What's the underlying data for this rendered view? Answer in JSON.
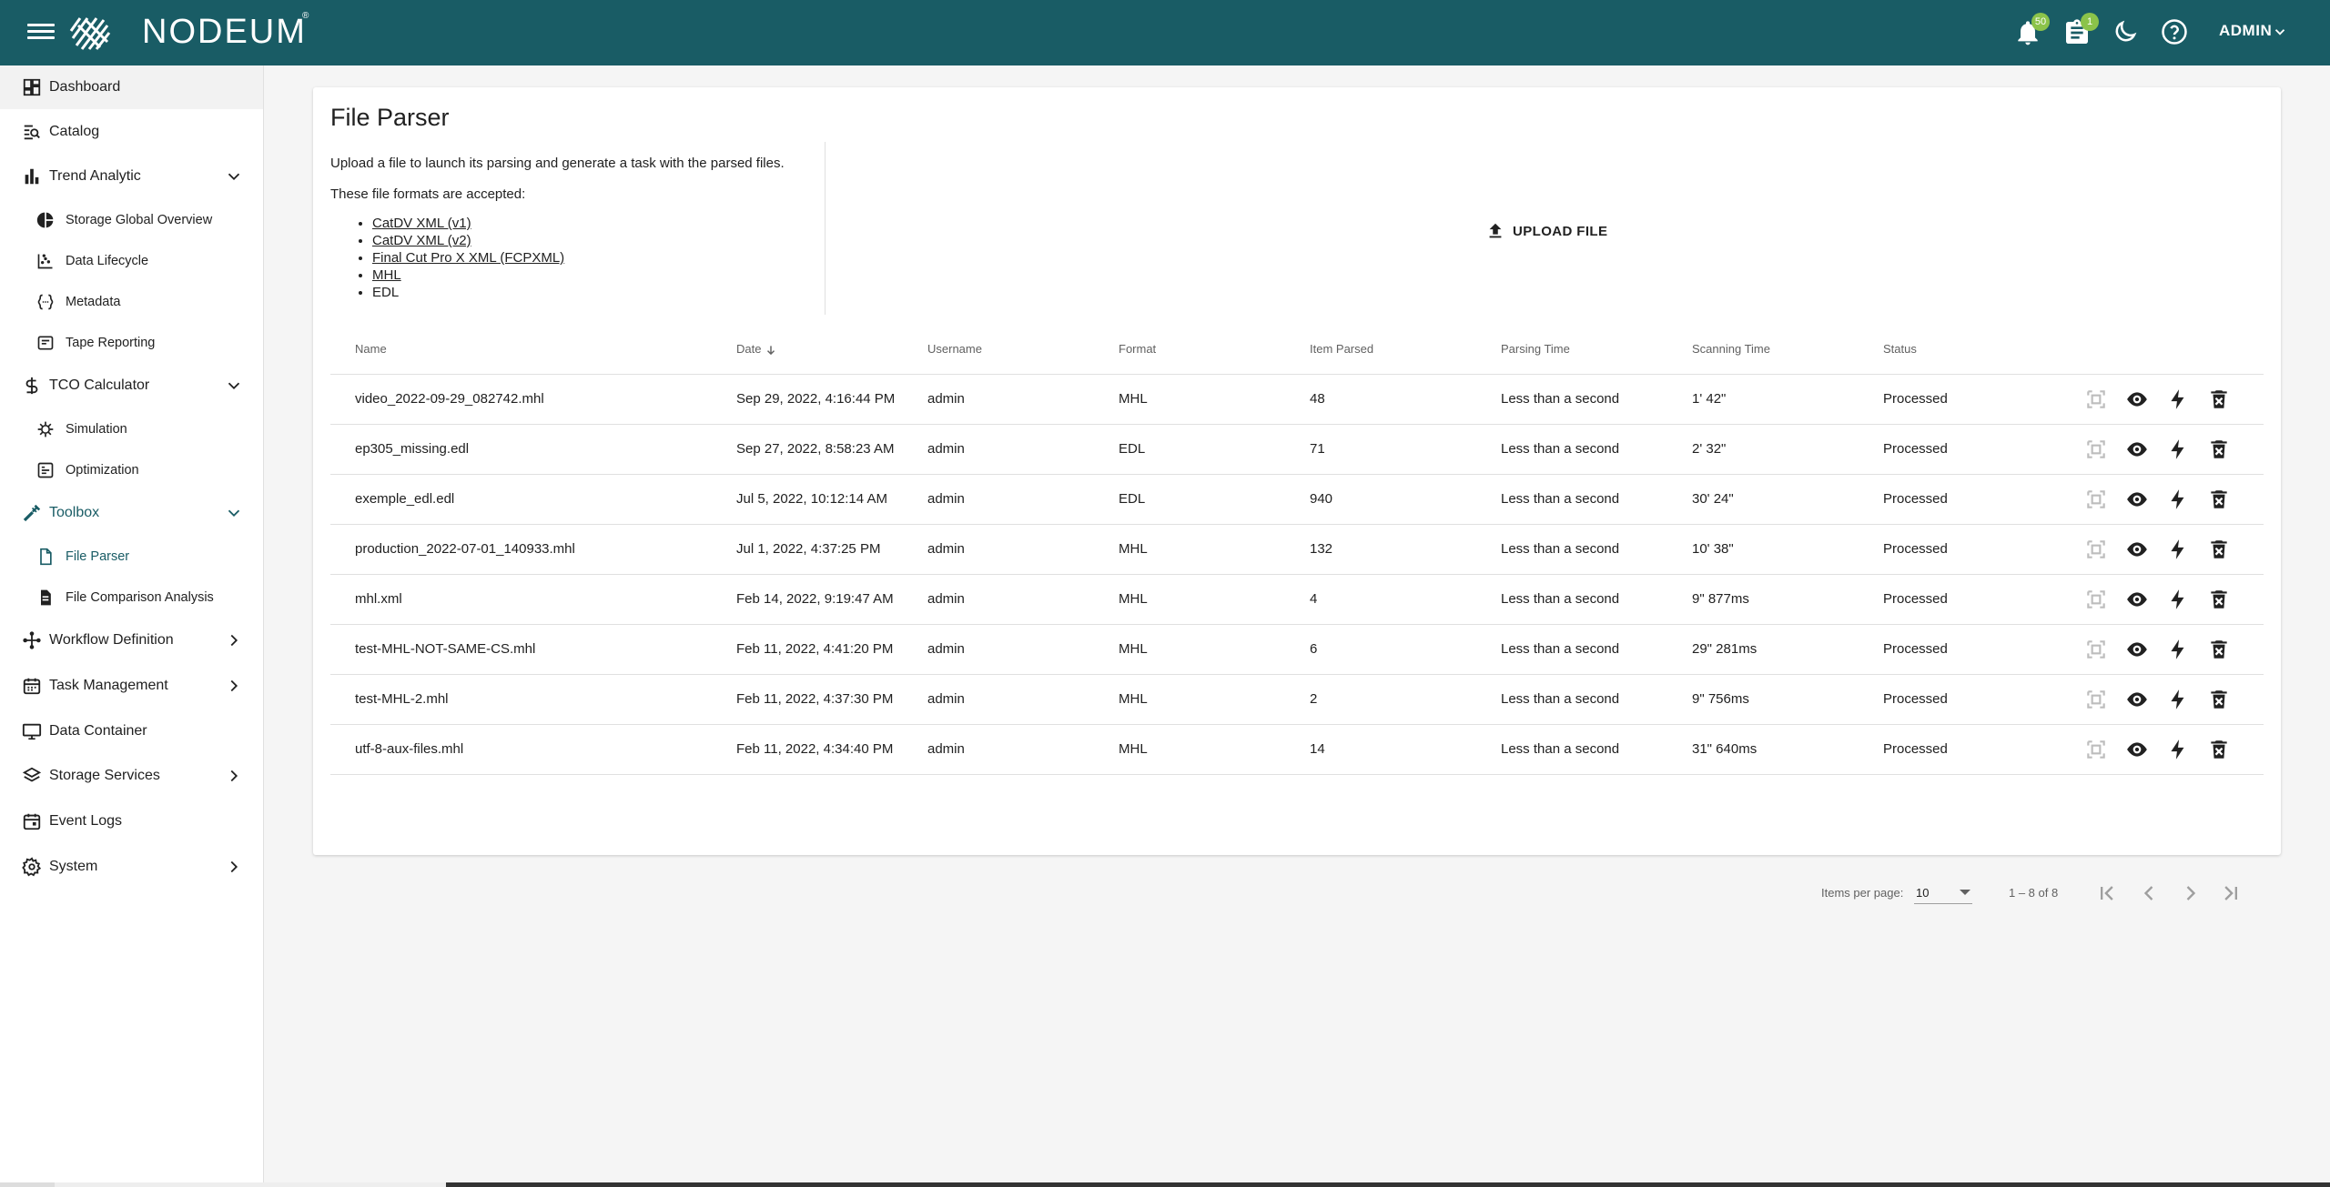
{
  "topbar": {
    "brand": "NODEUM",
    "registered": "®",
    "notifications_count": "50",
    "tasks_count": "1",
    "user_label": "ADMIN",
    "bg_color": "#195c65"
  },
  "sidebar": {
    "items": [
      {
        "label": "Dashboard",
        "icon": "dashboard-icon"
      },
      {
        "label": "Catalog",
        "icon": "catalog-search-icon"
      },
      {
        "label": "Trend Analytic",
        "icon": "bar-chart-icon"
      },
      {
        "label": "Storage Global Overview",
        "icon": "pie-chart-icon"
      },
      {
        "label": "Data Lifecycle",
        "icon": "scatter-chart-icon"
      },
      {
        "label": "Metadata",
        "icon": "code-braces-icon"
      },
      {
        "label": "Tape Reporting",
        "icon": "tape-report-icon"
      },
      {
        "label": "TCO Calculator",
        "icon": "dollar-icon"
      },
      {
        "label": "Simulation",
        "icon": "simulation-icon"
      },
      {
        "label": "Optimization",
        "icon": "optimization-icon"
      },
      {
        "label": "Toolbox",
        "icon": "tools-icon"
      },
      {
        "label": "File Parser",
        "icon": "file-icon"
      },
      {
        "label": "File Comparison Analysis",
        "icon": "file-compare-icon"
      },
      {
        "label": "Workflow Definition",
        "icon": "workflow-icon"
      },
      {
        "label": "Task Management",
        "icon": "calendar-icon"
      },
      {
        "label": "Data Container",
        "icon": "monitor-icon"
      },
      {
        "label": "Storage Services",
        "icon": "layers-icon"
      },
      {
        "label": "Event Logs",
        "icon": "event-icon"
      },
      {
        "label": "System",
        "icon": "gear-icon"
      }
    ]
  },
  "page": {
    "title": "File Parser",
    "intro_line1": "Upload a file to launch its parsing and generate a task with the parsed files.",
    "intro_line2": "These file formats are accepted:",
    "formats": [
      "CatDV XML (v1)",
      "CatDV XML (v2)",
      "Final Cut Pro X XML (FCPXML)",
      "MHL",
      "EDL"
    ],
    "upload_label": "UPLOAD FILE"
  },
  "table": {
    "headers": [
      "Name",
      "Date",
      "Username",
      "Format",
      "Item Parsed",
      "Parsing Time",
      "Scanning Time",
      "Status"
    ],
    "rows": [
      [
        "video_2022-09-29_082742.mhl",
        "Sep 29, 2022, 4:16:44 PM",
        "admin",
        "MHL",
        "48",
        "Less than a second",
        "1' 42\"",
        "Processed"
      ],
      [
        "ep305_missing.edl",
        "Sep 27, 2022, 8:58:23 AM",
        "admin",
        "EDL",
        "71",
        "Less than a second",
        "2' 32\"",
        "Processed"
      ],
      [
        "exemple_edl.edl",
        "Jul 5, 2022, 10:12:14 AM",
        "admin",
        "EDL",
        "940",
        "Less than a second",
        "30' 24\"",
        "Processed"
      ],
      [
        "production_2022-07-01_140933.mhl",
        "Jul 1, 2022, 4:37:25 PM",
        "admin",
        "MHL",
        "132",
        "Less than a second",
        "10' 38\"",
        "Processed"
      ],
      [
        "mhl.xml",
        "Feb 14, 2022, 9:19:47 AM",
        "admin",
        "MHL",
        "4",
        "Less than a second",
        "9\" 877ms",
        "Processed"
      ],
      [
        "test-MHL-NOT-SAME-CS.mhl",
        "Feb 11, 2022, 4:41:20 PM",
        "admin",
        "MHL",
        "6",
        "Less than a second",
        "29\" 281ms",
        "Processed"
      ],
      [
        "test-MHL-2.mhl",
        "Feb 11, 2022, 4:37:30 PM",
        "admin",
        "MHL",
        "2",
        "Less than a second",
        "9\" 756ms",
        "Processed"
      ],
      [
        "utf-8-aux-files.mhl",
        "Feb 11, 2022, 4:34:40 PM",
        "admin",
        "MHL",
        "14",
        "Less than a second",
        "31\" 640ms",
        "Processed"
      ]
    ]
  },
  "pagination": {
    "items_per_page_label": "Items per page:",
    "items_per_page_value": "10",
    "range": "1 – 8 of 8"
  }
}
